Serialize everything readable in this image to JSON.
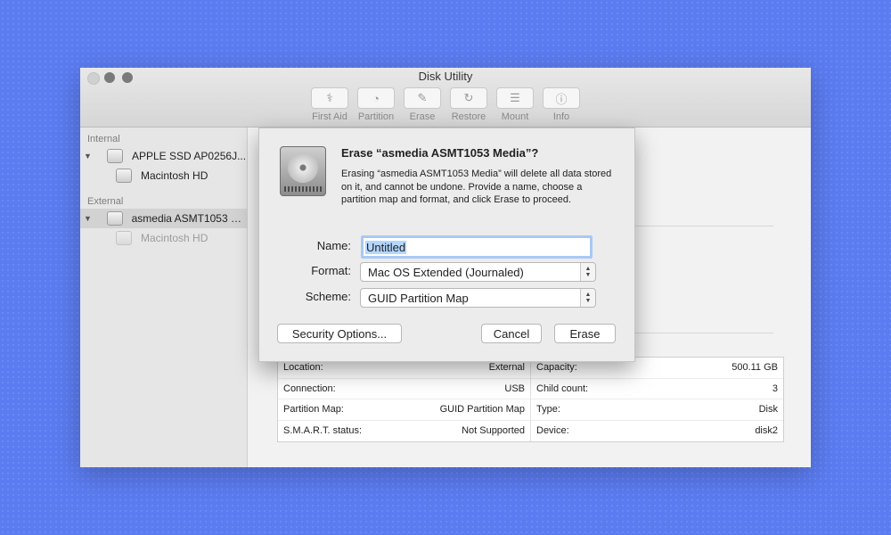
{
  "window": {
    "title": "Disk Utility"
  },
  "toolbar": {
    "items": [
      {
        "label": "First Aid",
        "icon": "stethoscope-icon",
        "glyph": "⚕"
      },
      {
        "label": "Partition",
        "icon": "partition-icon",
        "glyph": "◔"
      },
      {
        "label": "Erase",
        "icon": "erase-icon",
        "glyph": "✎"
      },
      {
        "label": "Restore",
        "icon": "restore-icon",
        "glyph": "↻"
      },
      {
        "label": "Mount",
        "icon": "mount-icon",
        "glyph": "☰"
      },
      {
        "label": "Info",
        "icon": "info-icon",
        "glyph": "ⓘ"
      }
    ]
  },
  "sidebar": {
    "internal_label": "Internal",
    "external_label": "External",
    "internal_disk": "APPLE SSD AP0256J...",
    "internal_volume": "Macintosh HD",
    "external_disk": "asmedia ASMT1053 M...",
    "external_volume": "Macintosh HD"
  },
  "dialog": {
    "title": "Erase “asmedia ASMT1053 Media”?",
    "message": "Erasing “asmedia ASMT1053 Media” will delete all data stored on it, and cannot be undone. Provide a name, choose a partition map and format, and click Erase to proceed.",
    "name_label": "Name:",
    "name_value": "Untitled",
    "format_label": "Format:",
    "format_value": "Mac OS Extended (Journaled)",
    "scheme_label": "Scheme:",
    "scheme_value": "GUID Partition Map",
    "security_button": "Security Options...",
    "cancel_button": "Cancel",
    "erase_button": "Erase"
  },
  "info": {
    "left": [
      {
        "label": "Location:",
        "value": "External"
      },
      {
        "label": "Connection:",
        "value": "USB"
      },
      {
        "label": "Partition Map:",
        "value": "GUID Partition Map"
      },
      {
        "label": "S.M.A.R.T. status:",
        "value": "Not Supported"
      }
    ],
    "right": [
      {
        "label": "Capacity:",
        "value": "500.11 GB"
      },
      {
        "label": "Child count:",
        "value": "3"
      },
      {
        "label": "Type:",
        "value": "Disk"
      },
      {
        "label": "Device:",
        "value": "disk2"
      }
    ]
  },
  "colors": {
    "background": "#5b7cf1",
    "usage_bar": "#1fc0f6",
    "focus_ring": "#a9c8f4"
  }
}
